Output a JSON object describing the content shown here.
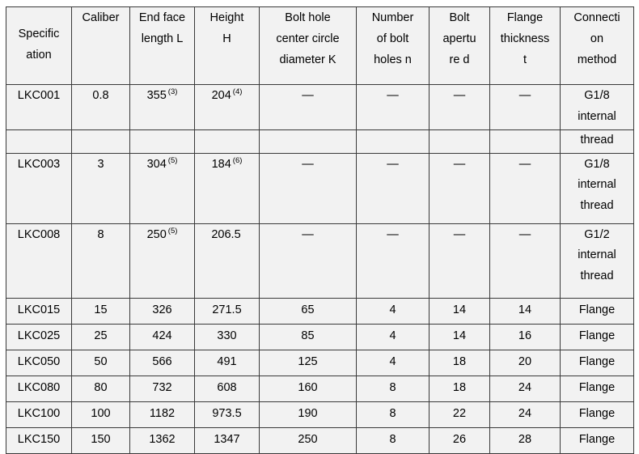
{
  "table": {
    "headers": [
      "Specification",
      "Caliber",
      "End face length L",
      "Height H",
      "Bolt hole center circle diameter K",
      "Number of bolt holes n",
      "Bolt aperture d",
      "Flange thickness t",
      "Connection method"
    ],
    "header_lines": {
      "col1": [
        "Specific",
        "ation"
      ],
      "col2": [
        "Caliber"
      ],
      "col3": [
        "End face",
        "length L"
      ],
      "col4": [
        "Height",
        "H"
      ],
      "col5": [
        "Bolt hole",
        "center circle",
        "diameter K"
      ],
      "col6": [
        "Number",
        "of bolt",
        "holes n"
      ],
      "col7": [
        "Bolt",
        "apertu",
        "re d"
      ],
      "col8": [
        "Flange",
        "thickness",
        "t"
      ],
      "col9": [
        "Connecti",
        "on",
        "method"
      ]
    },
    "dash": "—",
    "rows": [
      {
        "specification": "LKC001",
        "caliber": "0.8",
        "end_face_length": "355",
        "end_face_length_sup": "(3)",
        "height": "204",
        "height_sup": "(4)",
        "bolt_hole_circle": "—",
        "bolt_holes": "—",
        "bolt_aperture": "—",
        "flange_thickness": "—",
        "connection_lines": [
          "G1/8",
          "internal"
        ]
      },
      {
        "specification": "",
        "caliber": "",
        "end_face_length": "",
        "height": "",
        "bolt_hole_circle": "",
        "bolt_holes": "",
        "bolt_aperture": "",
        "flange_thickness": "",
        "connection_lines": [
          "thread"
        ]
      },
      {
        "specification": "LKC003",
        "caliber": "3",
        "end_face_length": "304",
        "end_face_length_sup": "(5)",
        "height": "184",
        "height_sup": "(6)",
        "bolt_hole_circle": "—",
        "bolt_holes": "—",
        "bolt_aperture": "—",
        "flange_thickness": "—",
        "connection_lines": [
          "G1/8",
          "internal",
          "thread"
        ]
      },
      {
        "specification": "LKC008",
        "caliber": "8",
        "end_face_length": "250",
        "end_face_length_sup": "(5)",
        "height": "206.5",
        "height_sup": "",
        "bolt_hole_circle": "—",
        "bolt_holes": "—",
        "bolt_aperture": "—",
        "flange_thickness": "—",
        "connection_lines": [
          "G1/2",
          "internal",
          "thread"
        ]
      },
      {
        "specification": "LKC015",
        "caliber": "15",
        "end_face_length": "326",
        "height": "271.5",
        "bolt_hole_circle": "65",
        "bolt_holes": "4",
        "bolt_aperture": "14",
        "flange_thickness": "14",
        "connection_lines": [
          "Flange"
        ]
      },
      {
        "specification": "LKC025",
        "caliber": "25",
        "end_face_length": "424",
        "height": "330",
        "bolt_hole_circle": "85",
        "bolt_holes": "4",
        "bolt_aperture": "14",
        "flange_thickness": "16",
        "connection_lines": [
          "Flange"
        ]
      },
      {
        "specification": "LKC050",
        "caliber": "50",
        "end_face_length": "566",
        "height": "491",
        "bolt_hole_circle": "125",
        "bolt_holes": "4",
        "bolt_aperture": "18",
        "flange_thickness": "20",
        "connection_lines": [
          "Flange"
        ]
      },
      {
        "specification": "LKC080",
        "caliber": "80",
        "end_face_length": "732",
        "height": "608",
        "bolt_hole_circle": "160",
        "bolt_holes": "8",
        "bolt_aperture": "18",
        "flange_thickness": "24",
        "connection_lines": [
          "Flange"
        ]
      },
      {
        "specification": "LKC100",
        "caliber": "100",
        "end_face_length": "1182",
        "height": "973.5",
        "bolt_hole_circle": "190",
        "bolt_holes": "8",
        "bolt_aperture": "22",
        "flange_thickness": "24",
        "connection_lines": [
          "Flange"
        ]
      },
      {
        "specification": "LKC150",
        "caliber": "150",
        "end_face_length": "1362",
        "height": "1347",
        "bolt_hole_circle": "250",
        "bolt_holes": "8",
        "bolt_aperture": "26",
        "flange_thickness": "28",
        "connection_lines": [
          "Flange"
        ]
      }
    ]
  },
  "colors": {
    "cell_background": "#f2f2f2",
    "border": "#3a3a3a",
    "text": "#000000",
    "page_background": "#ffffff"
  }
}
